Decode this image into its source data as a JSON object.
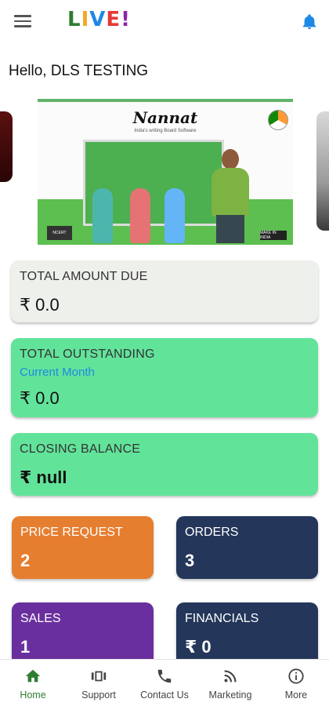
{
  "header": {
    "logo": [
      "L",
      "I",
      "V",
      "E",
      "!"
    ],
    "icons": {
      "menu": "hamburger-menu-icon",
      "notifications": "bell-icon"
    }
  },
  "greeting": "Hello, DLS TESTING",
  "banner": {
    "title": "Nannat",
    "subtitle": "India's writing Board Software",
    "tag_left": "NCERT",
    "tag_right": "MAKE IN INDIA"
  },
  "cards": {
    "total_amount_due": {
      "title": "TOTAL AMOUNT DUE",
      "value": "₹ 0.0"
    },
    "total_outstanding": {
      "title": "TOTAL OUTSTANDING",
      "subtitle": "Current Month",
      "value": "₹ 0.0"
    },
    "closing_balance": {
      "title": "CLOSING BALANCE",
      "value": "₹ null"
    }
  },
  "tiles": {
    "price_request": {
      "title": "PRICE REQUEST",
      "value": "2"
    },
    "orders": {
      "title": "ORDERS",
      "value": "3"
    },
    "sales": {
      "title": "SALES",
      "value": "1"
    },
    "financials": {
      "title": "FINANCIALS",
      "value": "₹ 0"
    }
  },
  "colors": {
    "accent_green": "#2e7d32",
    "bell_blue": "#1e88e5",
    "card_grey": "#eef0ec",
    "card_green": "#62e39a",
    "tile_orange": "#e67e30",
    "tile_navy": "#24365a",
    "tile_purple": "#6a2f9e"
  },
  "bottom_nav": [
    {
      "label": "Home",
      "icon": "home-icon",
      "active": true
    },
    {
      "label": "Support",
      "icon": "support-icon",
      "active": false
    },
    {
      "label": "Contact Us",
      "icon": "phone-icon",
      "active": false
    },
    {
      "label": "Marketing",
      "icon": "rss-icon",
      "active": false
    },
    {
      "label": "More",
      "icon": "info-icon",
      "active": false
    }
  ]
}
